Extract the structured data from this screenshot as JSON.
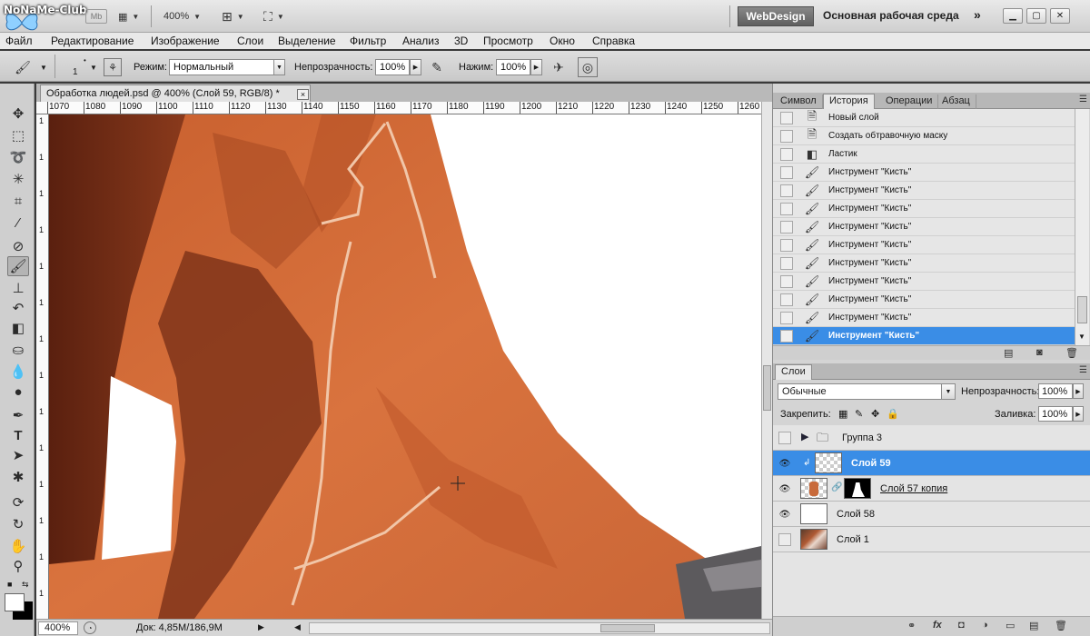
{
  "app": {
    "watermark": "NoNaMe-Club",
    "mb_badge": "Mb",
    "zoom_level": "400%",
    "workspace_button": "WebDesign",
    "workspace_name": "Основная рабочая среда",
    "more_glyph": "»"
  },
  "menu": [
    "Файл",
    "Редактирование",
    "Изображение",
    "Слои",
    "Выделение",
    "Фильтр",
    "Анализ",
    "3D",
    "Просмотр",
    "Окно",
    "Справка"
  ],
  "options": {
    "brush_size": "1",
    "mode_label": "Режим:",
    "mode_value": "Нормальный",
    "opacity_label": "Непрозрачность:",
    "opacity_value": "100%",
    "flow_label": "Нажим:",
    "flow_value": "100%"
  },
  "document": {
    "tab_title": "Обработка людей.psd @ 400% (Слой 59, RGB/8) *",
    "close_glyph": "×",
    "ruler_h": [
      "1070",
      "1080",
      "1090",
      "1100",
      "1110",
      "1120",
      "1130",
      "1140",
      "1150",
      "1160",
      "1170",
      "1180",
      "1190",
      "1200",
      "1210",
      "1220",
      "1230",
      "1240",
      "1250",
      "1260"
    ],
    "ruler_v": [
      "1",
      "1",
      "1",
      "1",
      "1",
      "1",
      "1",
      "1",
      "1",
      "1",
      "1",
      "1",
      "1",
      "1"
    ],
    "status_zoom": "400%",
    "status_doc": "Док: 4,85M/186,9M"
  },
  "panels": {
    "top_tabs": [
      "Символ",
      "История",
      "Операции",
      "Абзац"
    ],
    "top_active": 1,
    "history": [
      {
        "label": "Новый слой",
        "icon": "doc-icon"
      },
      {
        "label": "Создать обтравочную маску",
        "icon": "doc-icon"
      },
      {
        "label": "Ластик",
        "icon": "eraser-icon"
      },
      {
        "label": "Инструмент \"Кисть\"",
        "icon": "brush-icon"
      },
      {
        "label": "Инструмент \"Кисть\"",
        "icon": "brush-icon"
      },
      {
        "label": "Инструмент \"Кисть\"",
        "icon": "brush-icon"
      },
      {
        "label": "Инструмент \"Кисть\"",
        "icon": "brush-icon"
      },
      {
        "label": "Инструмент \"Кисть\"",
        "icon": "brush-icon"
      },
      {
        "label": "Инструмент \"Кисть\"",
        "icon": "brush-icon"
      },
      {
        "label": "Инструмент \"Кисть\"",
        "icon": "brush-icon"
      },
      {
        "label": "Инструмент \"Кисть\"",
        "icon": "brush-icon"
      },
      {
        "label": "Инструмент \"Кисть\"",
        "icon": "brush-icon"
      },
      {
        "label": "Инструмент \"Кисть\"",
        "icon": "brush-icon"
      }
    ],
    "history_selected": 12,
    "layers_tab": "Слои",
    "blend_mode": "Обычные",
    "layers_opacity_label": "Непрозрачность:",
    "layers_opacity_value": "100%",
    "lock_label": "Закрепить:",
    "fill_label": "Заливка:",
    "fill_value": "100%",
    "layers": [
      {
        "name": "Группа 3",
        "type": "group",
        "visible": false
      },
      {
        "name": "Слой 59",
        "type": "layer",
        "visible": true,
        "selected": true
      },
      {
        "name": "Слой 57 копия",
        "type": "masked",
        "visible": true
      },
      {
        "name": "Слой 58",
        "type": "layer",
        "visible": true
      },
      {
        "name": "Слой 1",
        "type": "photo",
        "visible": false
      }
    ]
  },
  "colors": {
    "selection": "#3a8de6",
    "skin": "#d9733e",
    "shadow": "#6b2a14"
  }
}
